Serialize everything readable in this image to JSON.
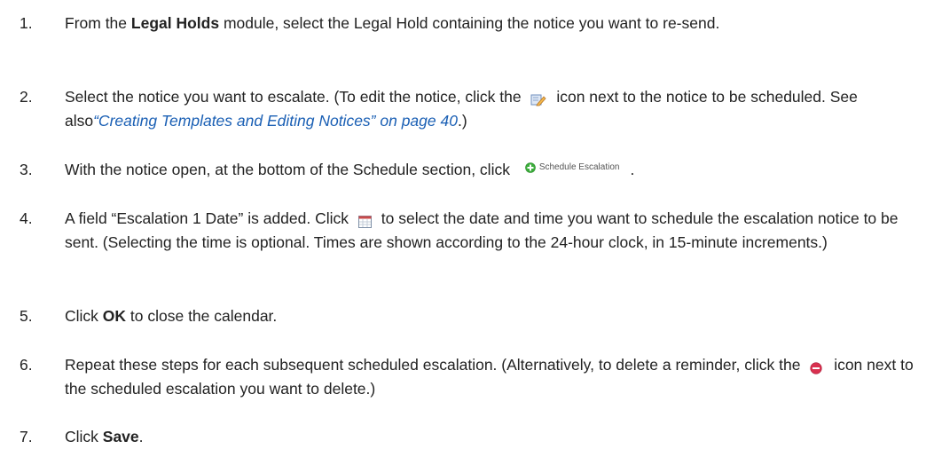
{
  "steps": [
    {
      "num": "1.",
      "pre": "From the ",
      "bold": "Legal Holds",
      "post": " module, select the Legal Hold containing the notice you want to re-send."
    },
    {
      "num": "2.",
      "pre": "Select the notice you want to escalate. (To edit the notice, click the ",
      "mid": " icon next to the notice to be scheduled. See also",
      "link": "“Creating Templates and Editing Notices” on page 40",
      "post": ".)"
    },
    {
      "num": "3.",
      "pre": "With the notice open, at the bottom of the Schedule section, click ",
      "button_label": "Schedule Escalation",
      "post": "."
    },
    {
      "num": "4.",
      "pre": "A field “Escalation 1 Date” is added. Click ",
      "post": " to select the date and time you want to schedule the escalation notice to be sent. (Selecting the time is optional. Times are shown according to the 24-hour clock, in 15-minute increments.)"
    },
    {
      "num": "5.",
      "pre": "Click ",
      "bold": "OK",
      "post": " to close the calendar."
    },
    {
      "num": "6.",
      "pre": "Repeat these steps for each subsequent scheduled escalation. (Alternatively, to delete a reminder, click the ",
      "post": " icon next to the scheduled escalation you want to delete.)"
    },
    {
      "num": "7.",
      "pre": "Click ",
      "bold": "Save",
      "post": "."
    }
  ],
  "icons": {
    "edit": "edit-icon",
    "schedule_add": "plus-circle-icon",
    "calendar": "calendar-icon",
    "delete": "minus-circle-icon"
  },
  "colors": {
    "link": "#1a5fb4",
    "text": "#222222",
    "add_green": "#3cae3c",
    "delete_red": "#d9304f"
  }
}
